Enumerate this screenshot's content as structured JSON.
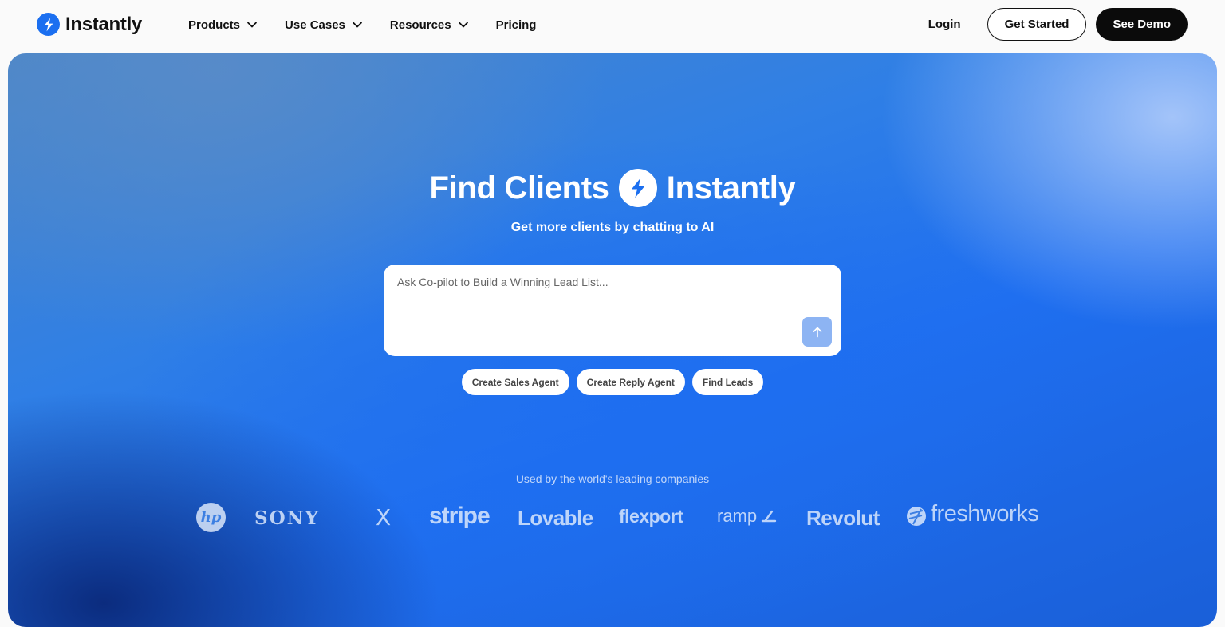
{
  "nav": {
    "brand": "Instantly",
    "menu": [
      {
        "label": "Products",
        "has_dropdown": true
      },
      {
        "label": "Use Cases",
        "has_dropdown": true
      },
      {
        "label": "Resources",
        "has_dropdown": true
      },
      {
        "label": "Pricing",
        "has_dropdown": false
      }
    ],
    "login": "Login",
    "get_started": "Get Started",
    "see_demo": "See Demo"
  },
  "hero": {
    "title_left": "Find Clients",
    "title_right": "Instantly",
    "subtitle": "Get more clients by chatting to AI",
    "prompt_placeholder": "Ask Co-pilot to Build a Winning Lead List...",
    "chips": [
      "Create Sales Agent",
      "Create Reply Agent",
      "Find Leads"
    ],
    "used_by": "Used by the world's leading companies",
    "companies": [
      "hp",
      "SONY",
      "X",
      "stripe",
      "Lovable",
      "flexport",
      "ramp",
      "Revolut",
      "freshworks"
    ]
  },
  "colors": {
    "brand_blue": "#1b6ff0",
    "hero_blue": "#1f6ff0",
    "dark_button": "#0b0b0b",
    "send_button": "#8db4f3"
  },
  "icons": {
    "logo": "lightning-bolt-icon",
    "dropdown": "chevron-down-icon",
    "send": "arrow-up-icon"
  }
}
